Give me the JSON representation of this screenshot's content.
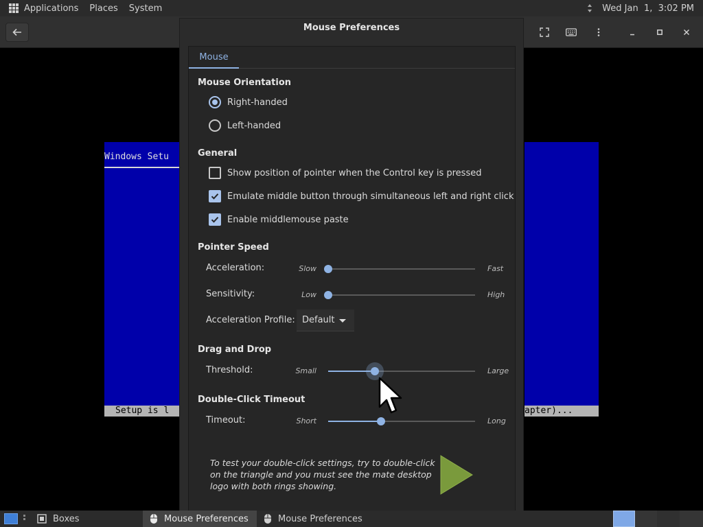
{
  "top_panel": {
    "menu": [
      "Applications",
      "Places",
      "System"
    ],
    "clock": "Wed Jan  1,  3:02 PM"
  },
  "vm": {
    "setup_title": "Windows Setu",
    "status_left": "Setup is l",
    "status_right": "apter)..."
  },
  "dialog": {
    "title": "Mouse Preferences",
    "tab": "Mouse",
    "orientation": {
      "heading": "Mouse Orientation",
      "options": [
        {
          "label": "Right-handed",
          "selected": true
        },
        {
          "label": "Left-handed",
          "selected": false
        }
      ]
    },
    "general": {
      "heading": "General",
      "options": [
        {
          "label": "Show position of pointer when the Control key is pressed",
          "checked": false
        },
        {
          "label": "Emulate middle button through simultaneous left and right click",
          "checked": true
        },
        {
          "label": "Enable middlemouse paste",
          "checked": true
        }
      ]
    },
    "pointer_speed": {
      "heading": "Pointer Speed",
      "acceleration": {
        "label": "Acceleration:",
        "min": "Slow",
        "max": "Fast",
        "value": 0.0
      },
      "sensitivity": {
        "label": "Sensitivity:",
        "min": "Low",
        "max": "High",
        "value": 0.0
      },
      "profile": {
        "label": "Acceleration Profile:",
        "value": "Default"
      }
    },
    "drag_drop": {
      "heading": "Drag and Drop",
      "threshold": {
        "label": "Threshold:",
        "min": "Small",
        "max": "Large",
        "value": 0.32
      }
    },
    "double_click": {
      "heading": "Double-Click Timeout",
      "timeout": {
        "label": "Timeout:",
        "min": "Short",
        "max": "Long",
        "value": 0.36
      }
    },
    "test_text": "To test your double-click settings, try to double-click on the triangle and you must see the mate desktop logo with both rings showing."
  },
  "taskbar": {
    "tasks": [
      "Boxes",
      "Mouse Preferences",
      "Mouse Preferences"
    ]
  },
  "colors": {
    "accent": "#8fb3e4",
    "vm_blue": "#0000aa",
    "triangle": "#7a9a3c"
  }
}
